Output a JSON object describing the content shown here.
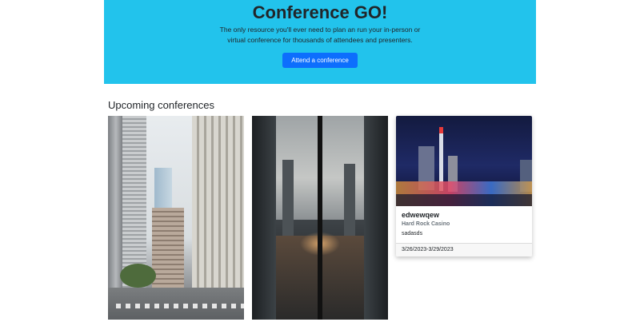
{
  "hero": {
    "title": "Conference GO!",
    "description_line1": "The only resource you'll ever need to plan an run your in-person or",
    "description_line2": "virtual conference for thousands of attendees and presenters.",
    "button_label": "Attend a conference",
    "background_color": "#22c3ec",
    "button_color": "#0d6efd"
  },
  "section": {
    "title": "Upcoming conferences"
  },
  "conferences": [
    {
      "image": "city-street-photo"
    },
    {
      "image": "city-reflection-photo"
    },
    {
      "image": "night-skyline-photo",
      "name": "edwewqew",
      "location": "Hard Rock Casino",
      "description": "sadasds",
      "dates": "3/26/2023-3/29/2023"
    }
  ]
}
